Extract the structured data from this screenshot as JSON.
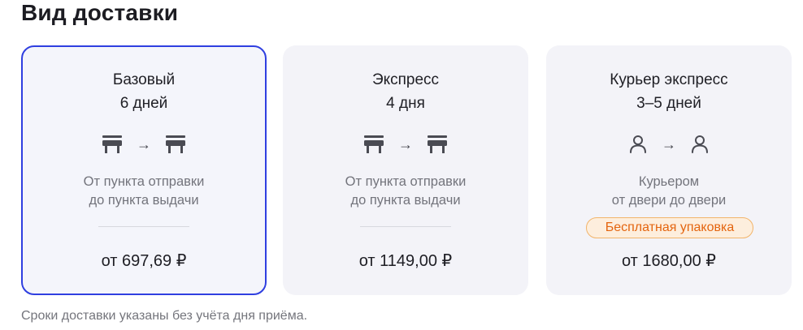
{
  "section_title": "Вид доставки",
  "options": [
    {
      "name": "Базовый",
      "duration": "6 дней",
      "icon_from": "pickup-point-icon",
      "icon_to": "pickup-point-icon",
      "arrow": "→",
      "desc_line1": "От пункта отправки",
      "desc_line2": "до пункта выдачи",
      "price": "от 697,69 ₽",
      "selected": true
    },
    {
      "name": "Экспресс",
      "duration": "4 дня",
      "icon_from": "pickup-point-icon",
      "icon_to": "pickup-point-icon",
      "arrow": "→",
      "desc_line1": "От пункта отправки",
      "desc_line2": "до пункта выдачи",
      "price": "от 1149,00 ₽",
      "selected": false
    },
    {
      "name": "Курьер экспресс",
      "duration": "3–5 дней",
      "icon_from": "person-icon",
      "icon_to": "person-icon",
      "arrow": "→",
      "desc_line1": "Курьером",
      "desc_line2": "от двери до двери",
      "badge": "Бесплатная упаковка",
      "price": "от 1680,00 ₽",
      "selected": false
    }
  ],
  "footnote": "Сроки доставки указаны без учёта дня приёма.",
  "colors": {
    "selected_border": "#2f3fe0",
    "card_bg": "#f3f3f8",
    "badge_text": "#e4650f",
    "badge_border": "#f2b46a",
    "badge_bg": "#fdeedd",
    "muted_text": "#73747c"
  }
}
